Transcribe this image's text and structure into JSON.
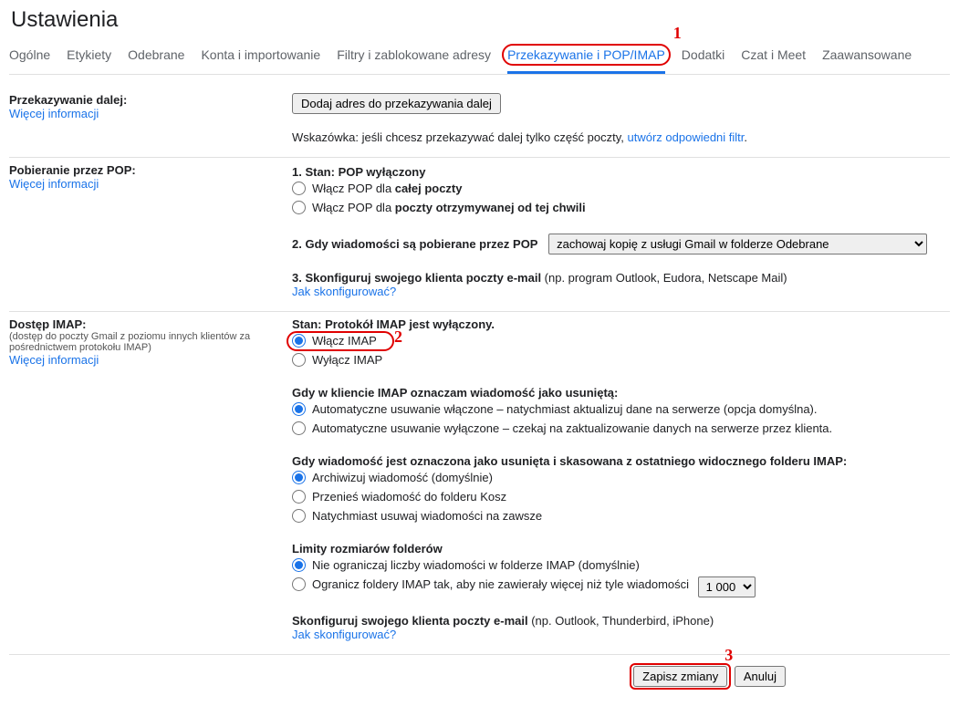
{
  "page_title": "Ustawienia",
  "tabs": {
    "general": "Ogólne",
    "labels": "Etykiety",
    "inbox": "Odebrane",
    "accounts": "Konta i importowanie",
    "filters": "Filtry i zablokowane adresy",
    "forwarding": "Przekazywanie i POP/IMAP",
    "addons": "Dodatki",
    "chat": "Czat i Meet",
    "advanced": "Zaawansowane"
  },
  "forwarding": {
    "title": "Przekazywanie dalej:",
    "more": "Więcej informacji",
    "add_button": "Dodaj adres do przekazywania dalej",
    "tip_prefix": "Wskazówka: jeśli chcesz przekazywać dalej tylko część poczty, ",
    "tip_link": "utwórz odpowiedni filtr",
    "tip_suffix": "."
  },
  "pop": {
    "title": "Pobieranie przez POP:",
    "more": "Więcej informacji",
    "state_prefix": "1. Stan: ",
    "state_value": "POP wyłączony",
    "opt_all_prefix": "Włącz POP dla ",
    "opt_all_bold": "całej poczty",
    "opt_now_prefix": "Włącz POP dla ",
    "opt_now_bold": "poczty otrzymywanej od tej chwili",
    "step2": "2. Gdy wiadomości są pobierane przez POP",
    "select_value": "zachowaj kopię z usługi Gmail w folderze Odebrane",
    "step3_bold": "3. Skonfiguruj swojego klienta poczty e-mail",
    "step3_rest": " (np. program Outlook, Eudora, Netscape Mail)",
    "how_link": "Jak skonfigurować?"
  },
  "imap": {
    "title": "Dostęp IMAP:",
    "sub": "(dostęp do poczty Gmail z poziomu innych klientów za pośrednictwem protokołu IMAP)",
    "more": "Więcej informacji",
    "state": "Stan: Protokół IMAP jest wyłączony.",
    "enable": "Włącz IMAP",
    "disable": "Wyłącz IMAP",
    "del_title": "Gdy w kliencie IMAP oznaczam wiadomość jako usuniętą:",
    "del_opt1": "Automatyczne usuwanie włączone – natychmiast aktualizuj dane na serwerze (opcja domyślna).",
    "del_opt2": "Automatyczne usuwanie wyłączone – czekaj na zaktualizowanie danych na serwerze przez klienta.",
    "exp_title": "Gdy wiadomość jest oznaczona jako usunięta i skasowana z ostatniego widocznego folderu IMAP:",
    "exp_opt1": "Archiwizuj wiadomość (domyślnie)",
    "exp_opt2": "Przenieś wiadomość do folderu Kosz",
    "exp_opt3": "Natychmiast usuwaj wiadomości na zawsze",
    "limit_title": "Limity rozmiarów folderów",
    "limit_opt1": "Nie ograniczaj liczby wiadomości w folderze IMAP (domyślnie)",
    "limit_opt2": "Ogranicz foldery IMAP tak, aby nie zawierały więcej niż tyle wiadomości",
    "limit_select": "1 000",
    "cfg_bold": "Skonfiguruj swojego klienta poczty e-mail",
    "cfg_rest": " (np. Outlook, Thunderbird, iPhone)",
    "how_link": "Jak skonfigurować?"
  },
  "actions": {
    "save": "Zapisz zmiany",
    "cancel": "Anuluj"
  },
  "annotations": {
    "n1": "1",
    "n2": "2",
    "n3": "3"
  }
}
